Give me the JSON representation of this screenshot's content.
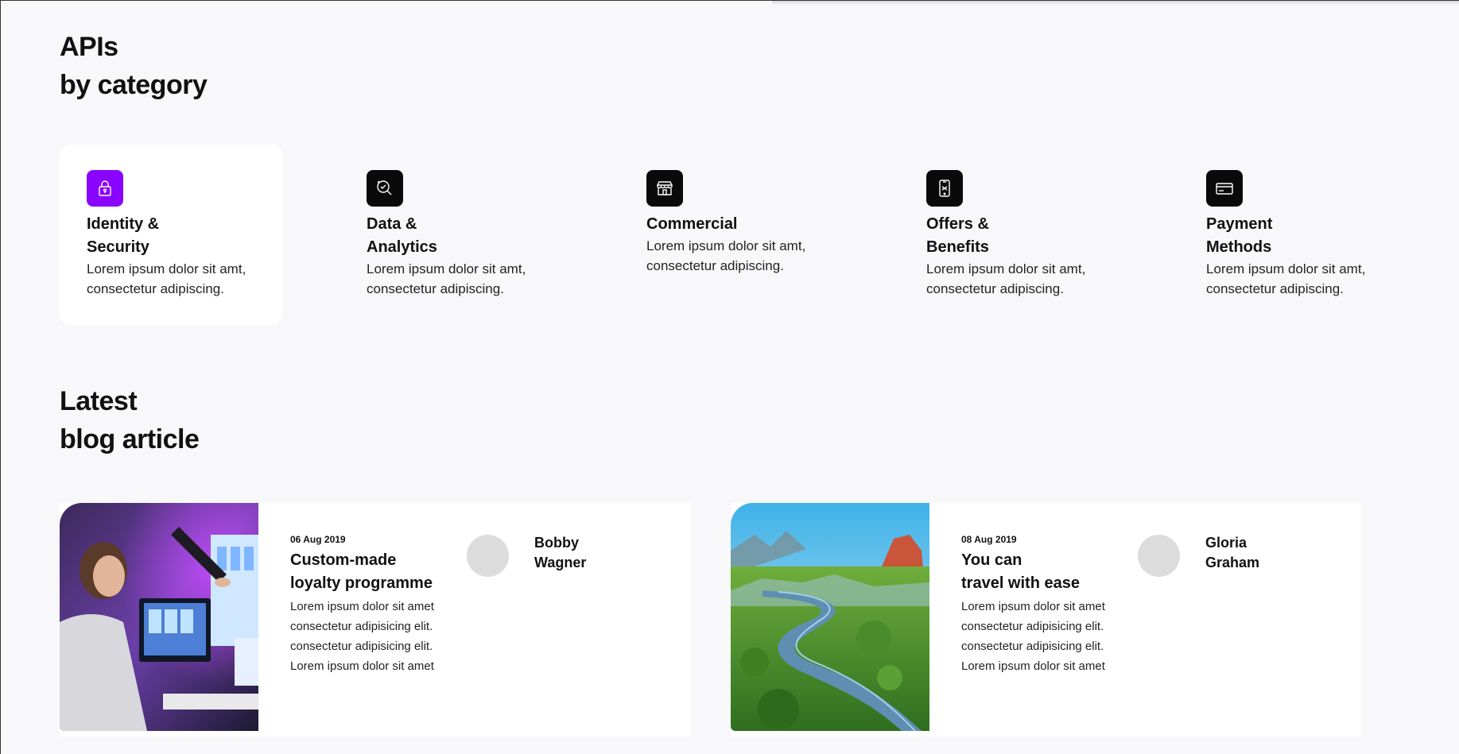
{
  "apis_section": {
    "title_line1": "APIs",
    "title_line2": "by category"
  },
  "categories": [
    {
      "title": "Identity &\nSecurity",
      "description": "Lorem ipsum dolor sit amt, consectetur adipiscing.",
      "icon": "lock-icon",
      "icon_color": "#8a05ff",
      "active": true
    },
    {
      "title": "Data &\nAnalytics",
      "description": "Lorem ipsum dolor sit amt, consectetur adipiscing.",
      "icon": "analytics-search-icon",
      "icon_color": "#0a0a0a",
      "active": false
    },
    {
      "title": "Commercial",
      "description": "Lorem ipsum dolor sit amt, consectetur adipiscing.",
      "icon": "storefront-icon",
      "icon_color": "#0a0a0a",
      "active": false
    },
    {
      "title": "Offers &\nBenefits",
      "description": "Lorem ipsum dolor sit amt, consectetur adipiscing.",
      "icon": "mobile-offer-icon",
      "icon_color": "#0a0a0a",
      "active": false
    },
    {
      "title": "Payment\nMethods",
      "description": "Lorem ipsum dolor sit amt, consectetur adipiscing.",
      "icon": "credit-card-icon",
      "icon_color": "#0a0a0a",
      "active": false
    }
  ],
  "blog_section": {
    "title_line1": "Latest",
    "title_line2": "blog article"
  },
  "articles": [
    {
      "date": "06 Aug 2019",
      "title": "Custom-made\nloyalty programme",
      "excerpt": "Lorem ipsum dolor sit amet\nconsectetur adipisicing elit.\nconsectetur adipisicing elit.\nLorem ipsum dolor sit amet",
      "author": "Bobby\nWagner",
      "image": "woman-at-computer-photo"
    },
    {
      "date": "08 Aug 2019",
      "title": "You can\ntravel with ease",
      "excerpt": "Lorem ipsum dolor sit amet\nconsectetur adipisicing elit.\nconsectetur adipisicing elit.\nLorem ipsum dolor sit amet",
      "author": "Gloria\nGraham",
      "image": "river-landscape-photo"
    }
  ]
}
